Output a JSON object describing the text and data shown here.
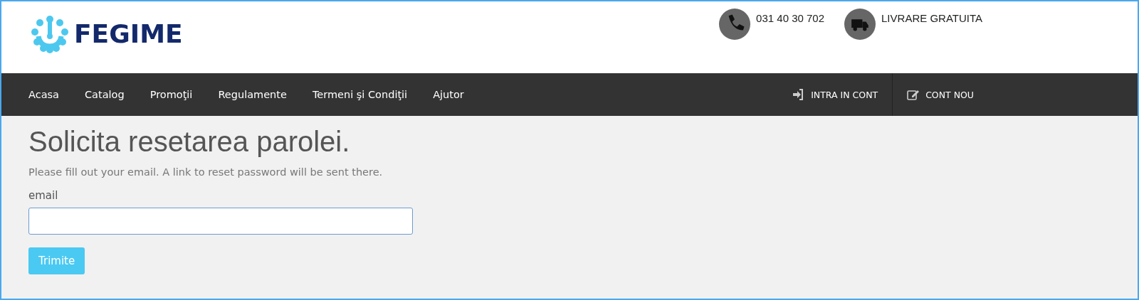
{
  "logo": {
    "text": "FEGIME"
  },
  "contacts": [
    {
      "kind": "phone",
      "text": "031 40 30 702"
    },
    {
      "kind": "truck",
      "text": "LIVRARE GRATUITA"
    }
  ],
  "nav": {
    "items": [
      {
        "label": "Acasa"
      },
      {
        "label": "Catalog"
      },
      {
        "label": "Promoţii"
      },
      {
        "label": "Regulamente"
      },
      {
        "label": "Termeni şi Condiţii"
      },
      {
        "label": "Ajutor"
      }
    ],
    "account": [
      {
        "kind": "login",
        "label": "INTRA IN CONT"
      },
      {
        "kind": "register",
        "label": "CONT NOU"
      }
    ]
  },
  "form": {
    "title": "Solicita resetarea parolei.",
    "description": "Please fill out your email. A link to reset password will be sent there.",
    "field_label": "email",
    "submit": "Trimite"
  }
}
